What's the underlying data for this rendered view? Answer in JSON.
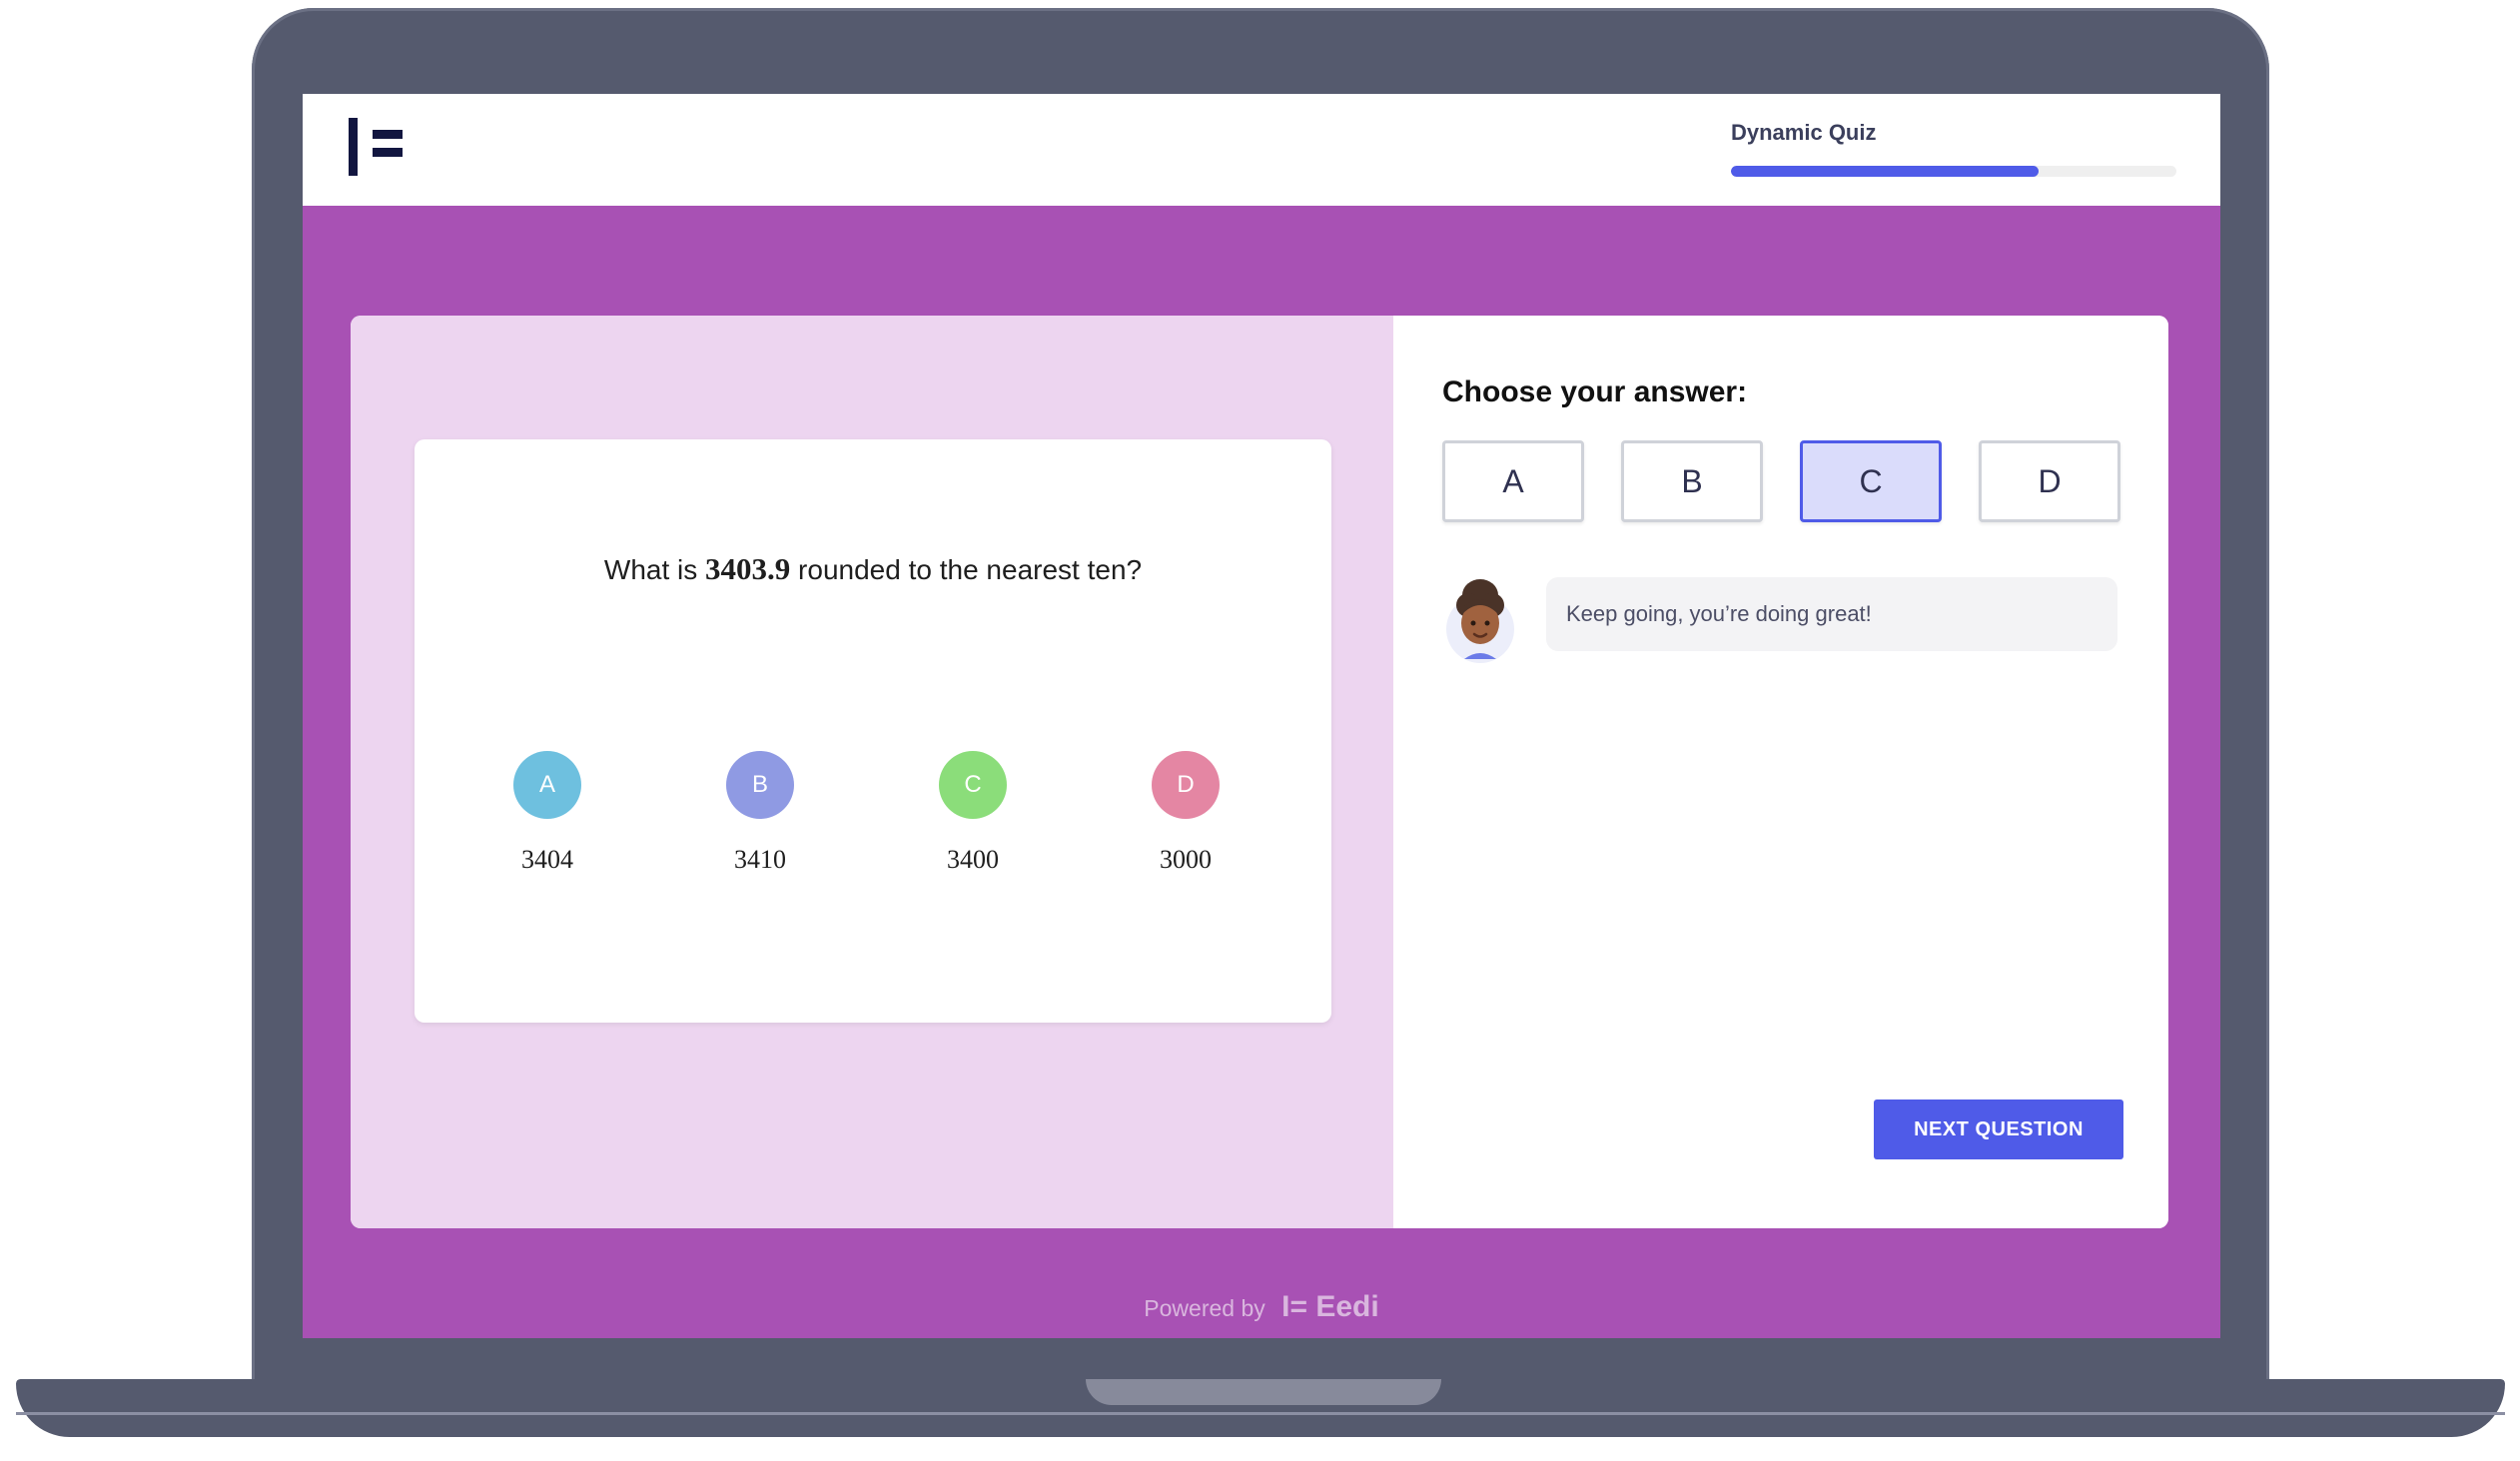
{
  "header": {
    "quiz_title": "Dynamic Quiz",
    "progress_fraction": 0.69
  },
  "question": {
    "prefix": "What is ",
    "number": "3403.9",
    "suffix": " rounded to the nearest ten?",
    "options": [
      {
        "letter": "A",
        "value": "3404",
        "color": "#6ec0df"
      },
      {
        "letter": "B",
        "value": "3410",
        "color": "#8f9ae3"
      },
      {
        "letter": "C",
        "value": "3400",
        "color": "#8bdd7a"
      },
      {
        "letter": "D",
        "value": "3000",
        "color": "#e486a3"
      }
    ]
  },
  "answer_panel": {
    "title": "Choose your answer:",
    "buttons": [
      "A",
      "B",
      "C",
      "D"
    ],
    "selected": "C",
    "feedback": "Keep going, you’re doing great!",
    "next_label": "NEXT QUESTION"
  },
  "footer": {
    "powered_by": "Powered by",
    "brand": "Eedi"
  },
  "colors": {
    "screen_background": "#a851b4",
    "left_pane": "#edd5f0",
    "accent": "#4f5be8"
  }
}
